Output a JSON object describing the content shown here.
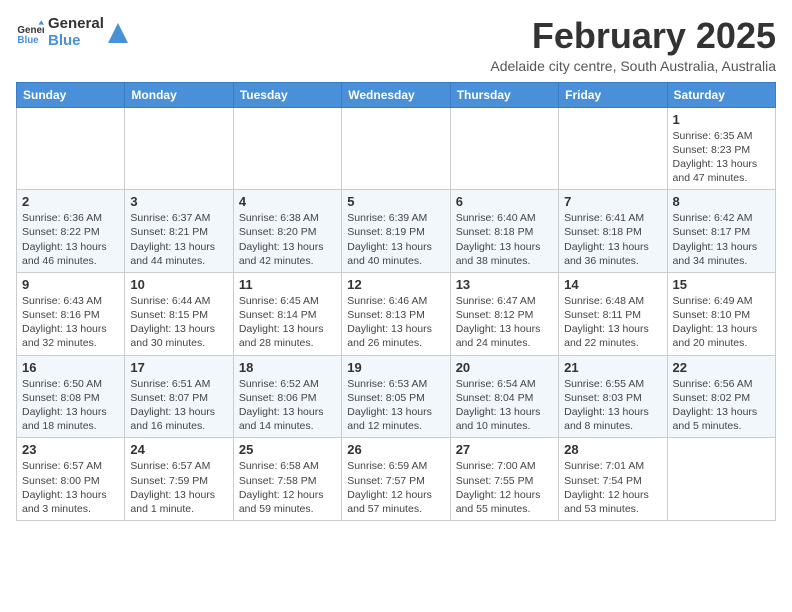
{
  "logo": {
    "text_general": "General",
    "text_blue": "Blue"
  },
  "header": {
    "month_title": "February 2025",
    "subtitle": "Adelaide city centre, South Australia, Australia"
  },
  "weekdays": [
    "Sunday",
    "Monday",
    "Tuesday",
    "Wednesday",
    "Thursday",
    "Friday",
    "Saturday"
  ],
  "weeks": [
    [
      {
        "day": "",
        "info": ""
      },
      {
        "day": "",
        "info": ""
      },
      {
        "day": "",
        "info": ""
      },
      {
        "day": "",
        "info": ""
      },
      {
        "day": "",
        "info": ""
      },
      {
        "day": "",
        "info": ""
      },
      {
        "day": "1",
        "info": "Sunrise: 6:35 AM\nSunset: 8:23 PM\nDaylight: 13 hours and 47 minutes."
      }
    ],
    [
      {
        "day": "2",
        "info": "Sunrise: 6:36 AM\nSunset: 8:22 PM\nDaylight: 13 hours and 46 minutes."
      },
      {
        "day": "3",
        "info": "Sunrise: 6:37 AM\nSunset: 8:21 PM\nDaylight: 13 hours and 44 minutes."
      },
      {
        "day": "4",
        "info": "Sunrise: 6:38 AM\nSunset: 8:20 PM\nDaylight: 13 hours and 42 minutes."
      },
      {
        "day": "5",
        "info": "Sunrise: 6:39 AM\nSunset: 8:19 PM\nDaylight: 13 hours and 40 minutes."
      },
      {
        "day": "6",
        "info": "Sunrise: 6:40 AM\nSunset: 8:18 PM\nDaylight: 13 hours and 38 minutes."
      },
      {
        "day": "7",
        "info": "Sunrise: 6:41 AM\nSunset: 8:18 PM\nDaylight: 13 hours and 36 minutes."
      },
      {
        "day": "8",
        "info": "Sunrise: 6:42 AM\nSunset: 8:17 PM\nDaylight: 13 hours and 34 minutes."
      }
    ],
    [
      {
        "day": "9",
        "info": "Sunrise: 6:43 AM\nSunset: 8:16 PM\nDaylight: 13 hours and 32 minutes."
      },
      {
        "day": "10",
        "info": "Sunrise: 6:44 AM\nSunset: 8:15 PM\nDaylight: 13 hours and 30 minutes."
      },
      {
        "day": "11",
        "info": "Sunrise: 6:45 AM\nSunset: 8:14 PM\nDaylight: 13 hours and 28 minutes."
      },
      {
        "day": "12",
        "info": "Sunrise: 6:46 AM\nSunset: 8:13 PM\nDaylight: 13 hours and 26 minutes."
      },
      {
        "day": "13",
        "info": "Sunrise: 6:47 AM\nSunset: 8:12 PM\nDaylight: 13 hours and 24 minutes."
      },
      {
        "day": "14",
        "info": "Sunrise: 6:48 AM\nSunset: 8:11 PM\nDaylight: 13 hours and 22 minutes."
      },
      {
        "day": "15",
        "info": "Sunrise: 6:49 AM\nSunset: 8:10 PM\nDaylight: 13 hours and 20 minutes."
      }
    ],
    [
      {
        "day": "16",
        "info": "Sunrise: 6:50 AM\nSunset: 8:08 PM\nDaylight: 13 hours and 18 minutes."
      },
      {
        "day": "17",
        "info": "Sunrise: 6:51 AM\nSunset: 8:07 PM\nDaylight: 13 hours and 16 minutes."
      },
      {
        "day": "18",
        "info": "Sunrise: 6:52 AM\nSunset: 8:06 PM\nDaylight: 13 hours and 14 minutes."
      },
      {
        "day": "19",
        "info": "Sunrise: 6:53 AM\nSunset: 8:05 PM\nDaylight: 13 hours and 12 minutes."
      },
      {
        "day": "20",
        "info": "Sunrise: 6:54 AM\nSunset: 8:04 PM\nDaylight: 13 hours and 10 minutes."
      },
      {
        "day": "21",
        "info": "Sunrise: 6:55 AM\nSunset: 8:03 PM\nDaylight: 13 hours and 8 minutes."
      },
      {
        "day": "22",
        "info": "Sunrise: 6:56 AM\nSunset: 8:02 PM\nDaylight: 13 hours and 5 minutes."
      }
    ],
    [
      {
        "day": "23",
        "info": "Sunrise: 6:57 AM\nSunset: 8:00 PM\nDaylight: 13 hours and 3 minutes."
      },
      {
        "day": "24",
        "info": "Sunrise: 6:57 AM\nSunset: 7:59 PM\nDaylight: 13 hours and 1 minute."
      },
      {
        "day": "25",
        "info": "Sunrise: 6:58 AM\nSunset: 7:58 PM\nDaylight: 12 hours and 59 minutes."
      },
      {
        "day": "26",
        "info": "Sunrise: 6:59 AM\nSunset: 7:57 PM\nDaylight: 12 hours and 57 minutes."
      },
      {
        "day": "27",
        "info": "Sunrise: 7:00 AM\nSunset: 7:55 PM\nDaylight: 12 hours and 55 minutes."
      },
      {
        "day": "28",
        "info": "Sunrise: 7:01 AM\nSunset: 7:54 PM\nDaylight: 12 hours and 53 minutes."
      },
      {
        "day": "",
        "info": ""
      }
    ]
  ]
}
